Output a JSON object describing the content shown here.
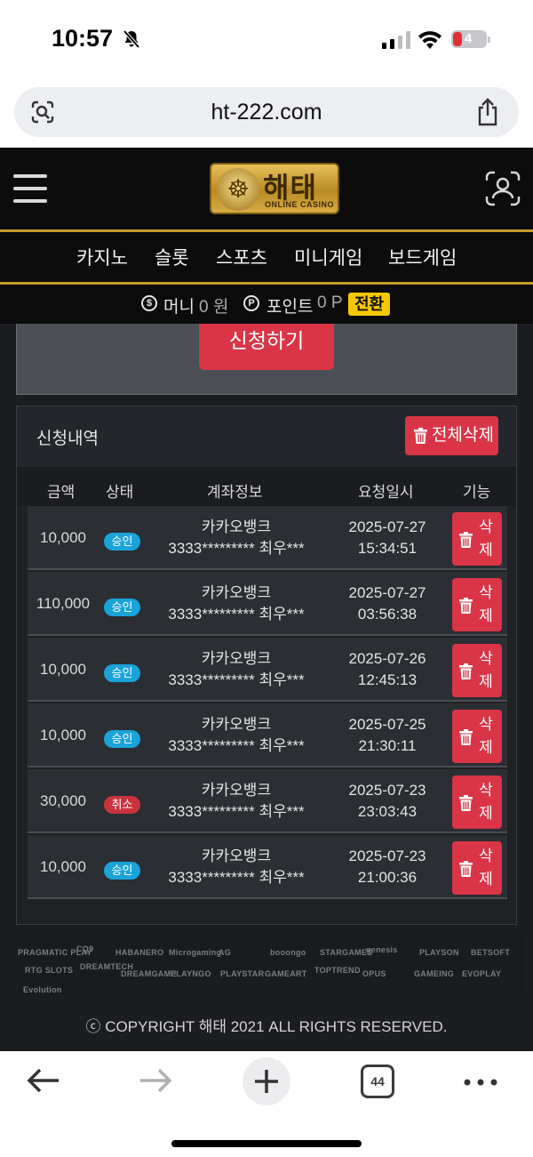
{
  "status_bar": {
    "time": "10:57",
    "battery": "4"
  },
  "browser": {
    "url": "ht-222.com",
    "tab_count": "44"
  },
  "site": {
    "logo_text": "해태",
    "logo_sub": "ONLINE CASINO",
    "nav": [
      "카지노",
      "슬롯",
      "스포츠",
      "미니게임",
      "보드게임"
    ]
  },
  "wallet": {
    "money_label": "머니",
    "money_value": "0 원",
    "point_label": "포인트",
    "point_value": "0 P",
    "convert_label": "전환"
  },
  "form": {
    "apply_label": "신청하기"
  },
  "history": {
    "title": "신청내역",
    "delete_all_label": "전체삭제",
    "columns": [
      "금액",
      "상태",
      "계좌정보",
      "요청일시",
      "기능"
    ],
    "delete_label_1": "삭",
    "delete_label_2": "제",
    "rows": [
      {
        "amount": "10,000",
        "status": "승인",
        "bank": "카카오뱅크",
        "account": "3333********* 최우***",
        "date": "2025-07-27",
        "time": "15:34:51"
      },
      {
        "amount": "110,000",
        "status": "승인",
        "bank": "카카오뱅크",
        "account": "3333********* 최우***",
        "date": "2025-07-27",
        "time": "03:56:38"
      },
      {
        "amount": "10,000",
        "status": "승인",
        "bank": "카카오뱅크",
        "account": "3333********* 최우***",
        "date": "2025-07-26",
        "time": "12:45:13"
      },
      {
        "amount": "10,000",
        "status": "승인",
        "bank": "카카오뱅크",
        "account": "3333********* 최우***",
        "date": "2025-07-25",
        "time": "21:30:11"
      },
      {
        "amount": "30,000",
        "status": "취소",
        "bank": "카카오뱅크",
        "account": "3333********* 최우***",
        "date": "2025-07-23",
        "time": "23:03:43"
      },
      {
        "amount": "10,000",
        "status": "승인",
        "bank": "카카오뱅크",
        "account": "3333********* 최우***",
        "date": "2025-07-23",
        "time": "21:00:36"
      }
    ]
  },
  "providers": [
    "PRAGMATIC PLAY",
    "CQ9",
    "HABANERO",
    "Microgaming",
    "AG",
    "booongo",
    "STARGAMES",
    "genesis",
    "PLAYSON",
    "BETSOFT",
    "RTG SLOTS",
    "DREAMTECH",
    "DREAMGAME",
    "PLAYNGO",
    "PLAYSTAR",
    "GAMEART",
    "TOPTREND",
    "OPUS",
    "GAMEING",
    "EVOPLAY",
    "Evolution"
  ],
  "footer": {
    "copyright": "ⓒ COPYRIGHT 해태 2021 ALL RIGHTS RESERVED."
  },
  "colors": {
    "accent_red": "#d93547",
    "gold": "#c79a2b",
    "approved": "#1aa3d9",
    "cancelled": "#c8333f",
    "convert": "#f6c800"
  }
}
